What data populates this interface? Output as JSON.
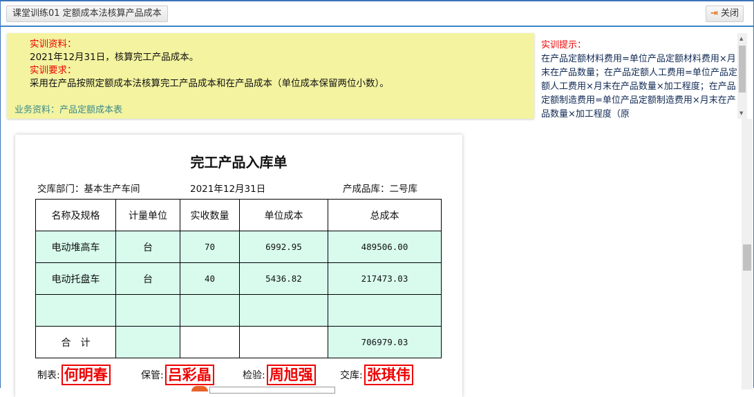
{
  "header": {
    "title": "课堂训练01 定额成本法核算产品成本",
    "close_label": "关闭",
    "close_icon": "exit-icon"
  },
  "info": {
    "material_label": "实训资料：",
    "material_text": "2021年12月31日，核算完工产品成本。",
    "req_label": "实训要求：",
    "req_text": "采用在产品按照定额成本法核算完工产品成本和在产品成本（单位成本保留两位小数）。",
    "biz_link": "业务资料：产品定额成本表"
  },
  "hint": {
    "label": "实训提示：",
    "text": "在产品定额材料费用=单位产品定额材料费用×月末在产品数量；在产品定额人工费用=单位产品定额人工费用×月末在产品数量×加工程度；在产品定额制造费用=单位产品定额制造费用×月末在产品数量×加工程度（原"
  },
  "doc": {
    "title": "完工产品入库单",
    "dept": "交库部门：基本生产车间",
    "date": "2021年12月31日",
    "store": "产成品库：二号库",
    "columns": [
      "名称及规格",
      "计量单位",
      "实收数量",
      "单位成本",
      "总成本"
    ],
    "rows": [
      [
        "电动堆高车",
        "台",
        "70",
        "6992.95",
        "489506.00"
      ],
      [
        "电动托盘车",
        "台",
        "40",
        "5436.82",
        "217473.03"
      ],
      [
        "",
        "",
        "",
        "",
        ""
      ]
    ],
    "total": {
      "label": "合　计",
      "amount": "706979.03"
    },
    "signatures": [
      {
        "role": "制表:",
        "name": "何明春"
      },
      {
        "role": "保管:",
        "name": "吕彩晶"
      },
      {
        "role": "检验:",
        "name": "周旭强"
      },
      {
        "role": "交库:",
        "name": "张琪伟"
      }
    ]
  }
}
